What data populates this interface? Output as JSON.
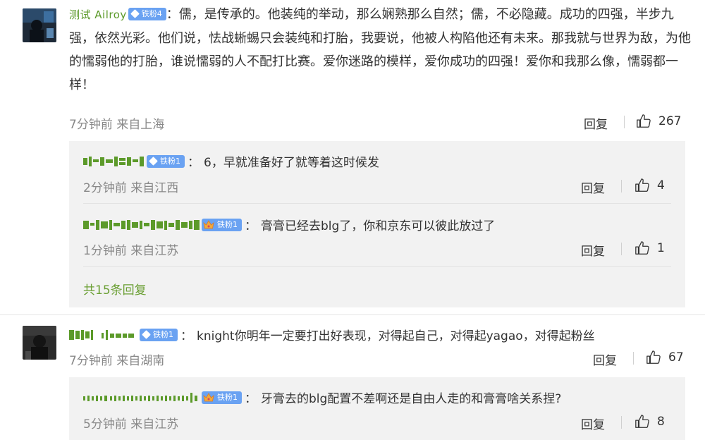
{
  "comments": [
    {
      "user": "测试 Ailroy",
      "badge": "铁粉4",
      "colon": "：",
      "text": "儒，是传承的。他装纯的举动，那么娴熟那么自然；儒，不必隐藏。成功的四强，半步九强，依然光彩。他们说，怯战蜥蜴只会装纯和打胎，我要说，他被人构陷他还有未来。那我就与世界为敌，为他的懦弱他的打胎，谁说懦弱的人不配打比赛。爱你迷路的模样，爱你成功的四强！爱你和我那么像，懦弱都一样！",
      "meta": "7分钟前 来自上海",
      "reply_label": "回复",
      "likes": "267",
      "replies": [
        {
          "badge": "铁粉1",
          "colon": "：",
          "text": "6，早就准备好了就等着这时候发",
          "meta": "2分钟前 来自江西",
          "reply_label": "回复",
          "likes": "4"
        },
        {
          "badge": "铁粉1",
          "colon": "：",
          "text": "膏膏已经去blg了，你和京东可以彼此放过了",
          "meta": "1分钟前 来自江苏",
          "reply_label": "回复",
          "likes": "1"
        }
      ],
      "more_replies": "共15条回复"
    },
    {
      "badge": "铁粉1",
      "colon": "：",
      "text": "knight你明年一定要打出好表现，对得起自己，对得起yagao，对得起粉丝",
      "meta": "7分钟前 来自湖南",
      "reply_label": "回复",
      "likes": "67",
      "replies": [
        {
          "badge": "铁粉1",
          "colon": "：",
          "text": "牙膏去的blg配置不差啊还是自由人走的和膏膏啥关系捏?",
          "meta": "5分钟前 来自江苏",
          "reply_label": "回复",
          "likes": "8"
        }
      ]
    }
  ],
  "colors": {
    "username": "#5c9a2a",
    "badge": "#6aa2f2",
    "meta": "#888888",
    "reply_bg": "#f2f2f2",
    "more_link": "#6a9f33"
  },
  "icons": {
    "like": "thumbs-up-icon",
    "gem": "diamond-icon",
    "crown": "crown-icon"
  }
}
